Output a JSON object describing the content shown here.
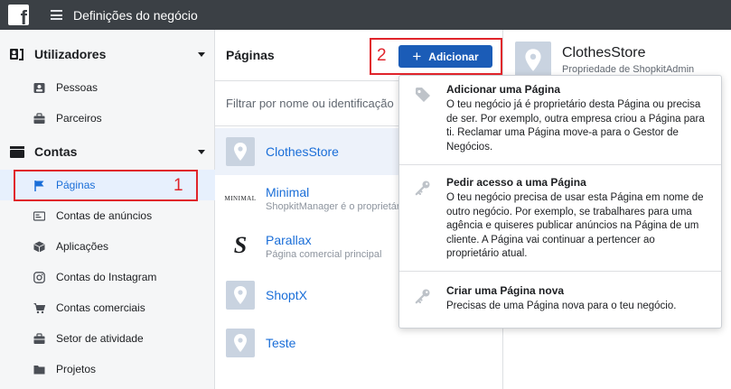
{
  "topbar": {
    "title": "Definições do negócio",
    "logo_icon": "facebook-logo",
    "menu_icon": "hamburger-icon"
  },
  "sidebar": {
    "users_section": {
      "title": "Utilizadores",
      "icon": "users-icon",
      "items": [
        {
          "label": "Pessoas",
          "icon": "person-card-icon"
        },
        {
          "label": "Parceiros",
          "icon": "briefcase-icon"
        }
      ]
    },
    "accounts_section": {
      "title": "Contas",
      "icon": "accounts-icon",
      "items": [
        {
          "label": "Páginas",
          "icon": "flag-icon",
          "active": true
        },
        {
          "label": "Contas de anúncios",
          "icon": "ad-account-icon"
        },
        {
          "label": "Aplicações",
          "icon": "cube-icon"
        },
        {
          "label": "Contas do Instagram",
          "icon": "instagram-icon"
        },
        {
          "label": "Contas comerciais",
          "icon": "cart-icon"
        },
        {
          "label": "Setor de atividade",
          "icon": "briefcase-icon"
        },
        {
          "label": "Projetos",
          "icon": "folder-icon"
        }
      ]
    }
  },
  "pages": {
    "title": "Páginas",
    "add_button": "Adicionar",
    "filter_placeholder": "Filtrar por nome ou identificação",
    "items": [
      {
        "name": "ClothesStore",
        "subtitle": "",
        "thumb": "placeholder-pin"
      },
      {
        "name": "Minimal",
        "subtitle": "ShopkitManager é o proprietário",
        "thumb": "minimal-logo",
        "thumb_text": "MINIMAL"
      },
      {
        "name": "Parallax",
        "subtitle": "Página comercial principal",
        "thumb": "s-logo",
        "thumb_text": "S"
      },
      {
        "name": "ShoptX",
        "subtitle": "",
        "thumb": "placeholder-pin"
      },
      {
        "name": "Teste",
        "subtitle": "",
        "thumb": "placeholder-pin"
      }
    ]
  },
  "detail": {
    "name": "ClothesStore",
    "subtitle": "Propriedade de ShopkitAdmin"
  },
  "dropdown": {
    "items": [
      {
        "title": "Adicionar uma Página",
        "description": "O teu negócio já é proprietário desta Página ou precisa de ser. Por exemplo, outra empresa criou a Página para ti. Reclamar uma Página move-a para o Gestor de Negócios.",
        "icon": "tag-icon"
      },
      {
        "title": "Pedir acesso a uma Página",
        "description": "O teu negócio precisa de usar esta Página em nome de outro negócio. Por exemplo, se trabalhares para uma agência e quiseres publicar anúncios na Página de um cliente. A Página vai continuar a pertencer ao proprietário atual.",
        "icon": "key-icon"
      },
      {
        "title": "Criar uma Página nova",
        "description": "Precisas de uma Página nova para o teu negócio.",
        "icon": "key-icon"
      }
    ]
  },
  "annotations": {
    "first": "1",
    "second": "2"
  },
  "colors": {
    "topbar": "#3b4045",
    "link": "#1a6ed8",
    "button": "#1b5cb7",
    "annotation": "#e0242b",
    "active_bg": "#e7f0fd"
  }
}
